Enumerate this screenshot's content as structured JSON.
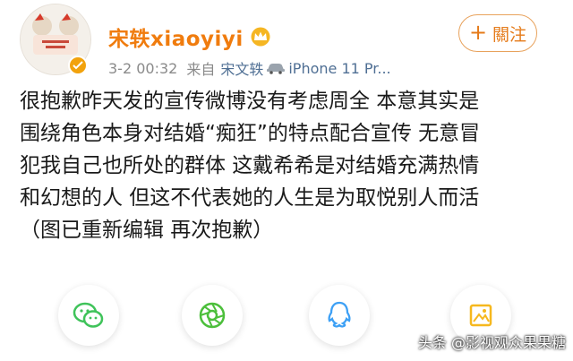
{
  "post": {
    "username": "宋轶xiaoyiyi",
    "time": "3-2 00:32",
    "from_label": "来自",
    "source_name": "宋文轶",
    "device": "iPhone 11 Pr...",
    "follow_label": "關注",
    "follow_plus": "+",
    "text": "很抱歉昨天发的宣传微博没有考虑周全 本意其实是\n围绕角色本身对结婚“痴狂”的特点配合宣传 无意冒\n犯我自己也所处的群体 这戴希希是对结婚充满热情\n和幻想的人 但这不代表她的人生是为取悦别人而活\n（图已重新编辑 再次抱歉）"
  },
  "share": {
    "items": [
      {
        "icon": "wechat-icon"
      },
      {
        "icon": "moments-icon"
      },
      {
        "icon": "qq-icon"
      },
      {
        "icon": "qzone-icon"
      }
    ]
  },
  "watermark": "头条 @影视观众果果糖",
  "colors": {
    "username": "#f07c0e",
    "follow": "#e57b1a",
    "source": "#4f6f94",
    "share_wechat": "#3fc35a",
    "share_moments": "#4cbf3b",
    "share_qq": "#3da0f5",
    "share_qzone": "#f6b81e"
  }
}
